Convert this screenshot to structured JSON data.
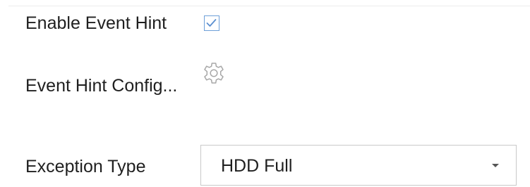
{
  "form": {
    "enable_event_hint": {
      "label": "Enable Event Hint",
      "checked": true
    },
    "event_hint_config": {
      "label": "Event Hint Config...",
      "icon": "gear-icon"
    },
    "exception_type": {
      "label": "Exception Type",
      "selected": "HDD Full",
      "icon": "caret-down-icon"
    }
  },
  "colors": {
    "checkbox_border": "#6d9fd8",
    "checkmark": "#5b8fd0",
    "gear": "#a7a7a7",
    "select_border": "#c9c9c9",
    "text": "#1f1f1f"
  }
}
